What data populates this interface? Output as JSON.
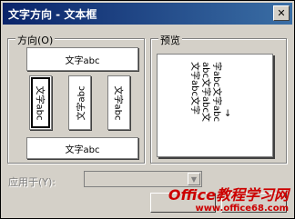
{
  "window": {
    "title": "文字方向 - 文本框",
    "close_icon": "close-icon"
  },
  "orientation_group": {
    "label": "方向(O)",
    "options": [
      {
        "label": "文字abc",
        "orientation": "horizontal"
      },
      {
        "label": "文字abc",
        "orientation": "vertical-selected",
        "selected": true
      },
      {
        "label": "文字abc",
        "orientation": "vertical-ccw"
      },
      {
        "label": "文字abc",
        "orientation": "vertical-cw"
      },
      {
        "label": "文字abc",
        "orientation": "horizontal-bottom"
      }
    ]
  },
  "preview_group": {
    "label": "预览",
    "lines": [
      "文字abc文字",
      "abc文字abc文",
      "字abc文字abc",
      "→"
    ]
  },
  "apply_to": {
    "label": "应用于(Y):",
    "value": ""
  },
  "watermark": {
    "line1": "Office教程学习网",
    "line2": "www.office68.com"
  }
}
